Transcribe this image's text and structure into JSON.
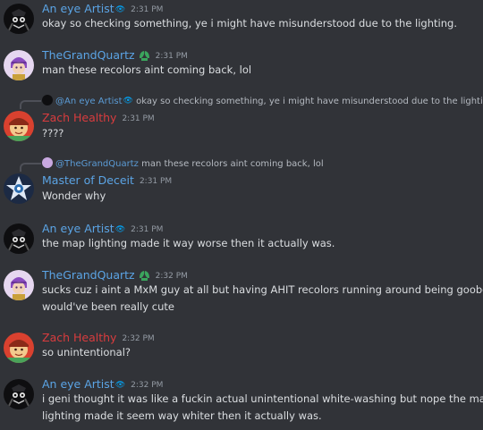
{
  "colors": {
    "background": "#313338",
    "anEyeArtist": "#5ba4e5",
    "theGrandQuartz": "#5ba4e5",
    "zachHealthy": "#d83c3e",
    "masterOfDeceit": "#5ba4e5",
    "timestamp": "#949ba4",
    "text": "#dbdee1"
  },
  "messages": [
    {
      "author": "An eye Artist",
      "eye": "👁",
      "time": "2:31 PM",
      "text": "okay so checking something, ye i might have misunderstood due to the lighting."
    },
    {
      "author": "TheGrandQuartz",
      "time": "2:31 PM",
      "text": "man these recolors aint coming back, lol"
    },
    {
      "reply_to": "@An eye Artist",
      "reply_eye": "👁",
      "reply_text": "okay so checking something, ye i might have misunderstood due to the lighting.",
      "author": "Zach Healthy",
      "time": "2:31 PM",
      "text": "????"
    },
    {
      "reply_to": "@TheGrandQuartz",
      "reply_text": "man these recolors aint coming back, lol",
      "author": "Master of Deceit",
      "time": "2:31 PM",
      "text": "Wonder why"
    },
    {
      "author": "An eye Artist",
      "eye": "👁",
      "time": "2:31 PM",
      "text": "the map lighting made it way worse then it actually was."
    },
    {
      "author": "TheGrandQuartz",
      "time": "2:32 PM",
      "text1": "sucks cuz i aint a MxM guy at all but having AHIT recolors running around being goobers",
      "text2": "would've been really cute"
    },
    {
      "author": "Zach Healthy",
      "time": "2:32 PM",
      "text": "so unintentional?"
    },
    {
      "author": "An eye Artist",
      "eye": "👁",
      "time": "2:32 PM",
      "text1": "i geni thought it was like a fuckin actual unintentional white-washing but nope the map",
      "text2": "lighting made it seem way whiter then it actually was."
    }
  ]
}
